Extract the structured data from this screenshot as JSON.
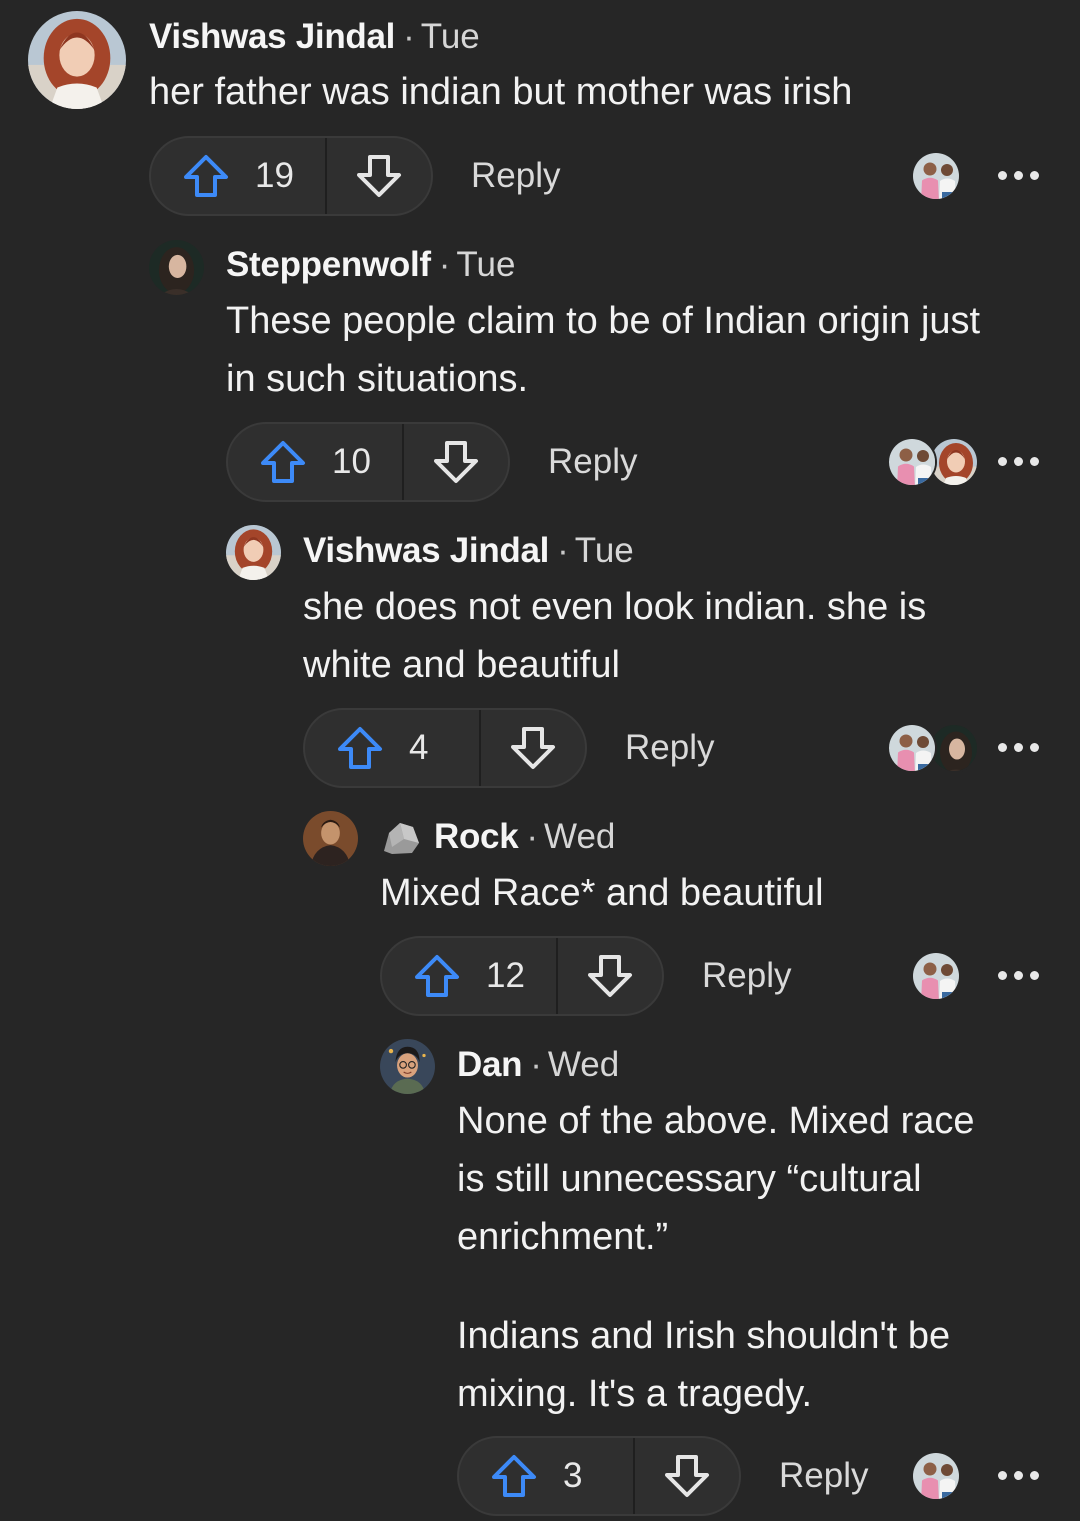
{
  "colors": {
    "background": "#262626",
    "upvote_icon": "#3d8af7",
    "pill_bg": "#2f2f2f"
  },
  "comments": [
    {
      "author": "Vishwas Jindal",
      "time": "Tue",
      "body": [
        "her father was indian but mother was irish"
      ],
      "votes": "19",
      "reply_label": "Reply",
      "avatar": "woman-red-hair-avatar",
      "reactors": [
        "man-pink-shirt-avatar"
      ]
    },
    {
      "author": "Steppenwolf",
      "time": "Tue",
      "body": [
        "These people claim to be of Indian origin just",
        "in such situations."
      ],
      "votes": "10",
      "reply_label": "Reply",
      "avatar": "woman-dark-hair-avatar",
      "reactors": [
        "man-pink-shirt-avatar",
        "woman-red-hair-avatar"
      ]
    },
    {
      "author": "Vishwas Jindal",
      "time": "Tue",
      "body": [
        "she does not even look indian. she is",
        "white and beautiful"
      ],
      "votes": "4",
      "reply_label": "Reply",
      "avatar": "woman-red-hair-avatar",
      "reactors": [
        "man-pink-shirt-avatar",
        "woman-dark-hair-avatar"
      ]
    },
    {
      "author": "Rock",
      "time": "Wed",
      "flair_icon": "rock-icon",
      "body": [
        "Mixed Race* and beautiful"
      ],
      "votes": "12",
      "reply_label": "Reply",
      "avatar": "man-leather-jacket-avatar",
      "reactors": [
        "man-pink-shirt-avatar"
      ]
    },
    {
      "author": "Dan",
      "time": "Wed",
      "body": [
        "None of the above. Mixed race",
        "is still unnecessary “cultural",
        "enrichment.”",
        "",
        "Indians and Irish shouldn't be",
        "mixing. It's a tragedy."
      ],
      "votes": "3",
      "reply_label": "Reply",
      "avatar": "cartoon-man-glasses-avatar",
      "reactors": [
        "man-pink-shirt-avatar"
      ]
    }
  ]
}
